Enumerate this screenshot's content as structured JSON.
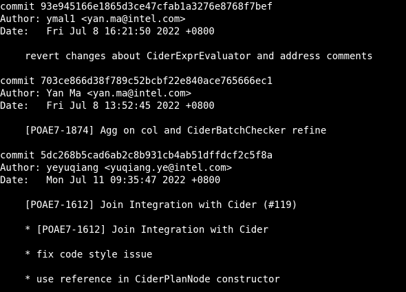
{
  "terminal": {
    "background": "#000000",
    "foreground": "#ffffff",
    "commits": [
      {
        "commit_line": "commit 93e945166e1865d3ce47cfab1a3276e8768f7bef",
        "author_line": "Author: ymal1 <yan.ma@intel.com>",
        "date_line": "Date:   Fri Jul 8 16:21:50 2022 +0800",
        "message_lines": [
          "revert changes about CiderExprEvaluator and address comments"
        ]
      },
      {
        "commit_line": "commit 703ce866d38f789c52bcbf22e840ace765666ec1",
        "author_line": "Author: Yan Ma <yan.ma@intel.com>",
        "date_line": "Date:   Fri Jul 8 13:52:45 2022 +0800",
        "message_lines": [
          "[POAE7-1874] Agg on col and CiderBatchChecker refine"
        ]
      },
      {
        "commit_line": "commit 5dc268b5cad6ab2c8b931cb4ab51dffdcf2c5f8a",
        "author_line": "Author: yeyuqiang <yuqiang.ye@intel.com>",
        "date_line": "Date:   Mon Jul 11 09:35:47 2022 +0800",
        "message_lines": [
          "[POAE7-1612] Join Integration with Cider (#119)",
          "* [POAE7-1612] Join Integration with Cider",
          "* fix code style issue",
          "* use reference in CiderPlanNode constructor"
        ]
      }
    ]
  }
}
